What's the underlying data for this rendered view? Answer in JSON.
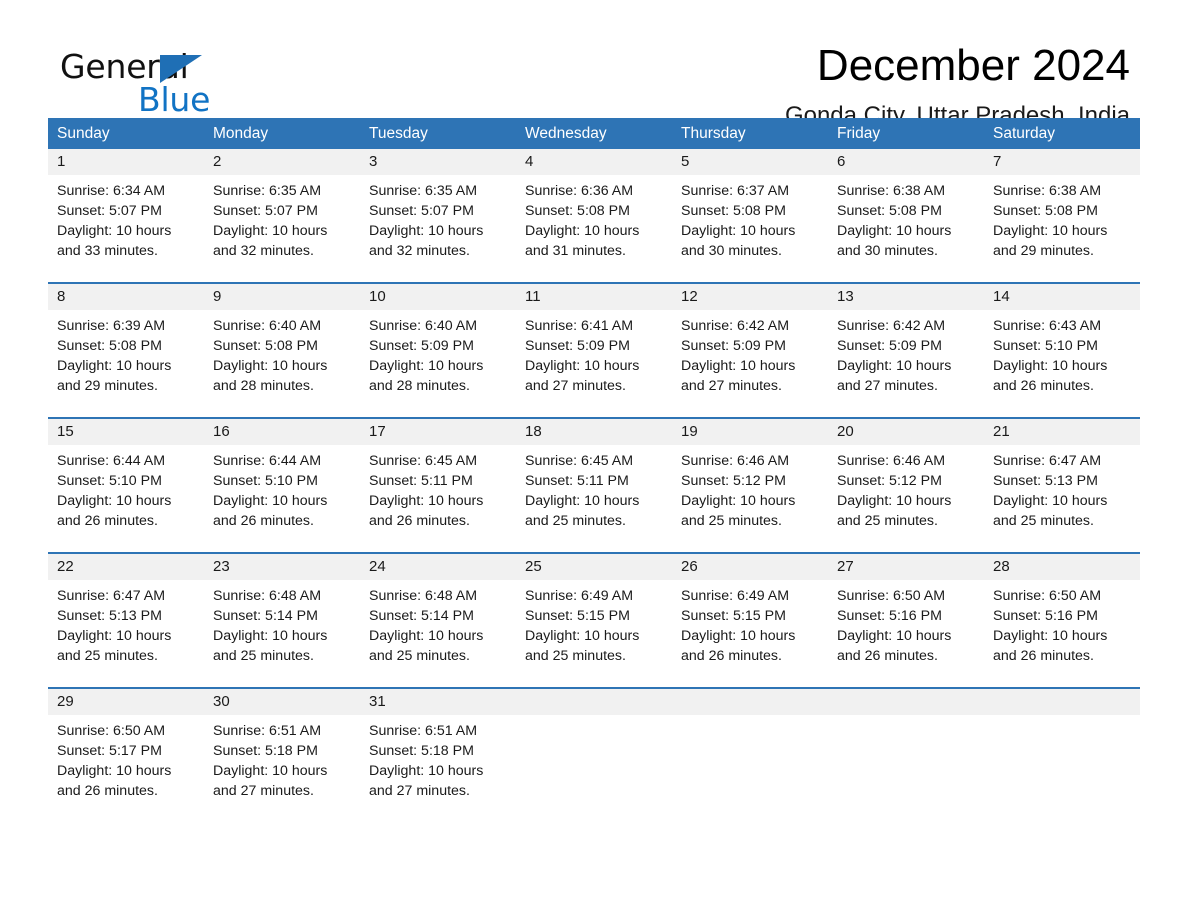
{
  "brand": {
    "word_black": "General",
    "word_blue": "Blue",
    "triangle_color": "#1f6fb5",
    "blue_color": "#1173c4"
  },
  "header": {
    "title": "December 2024",
    "location": "Gonda City, Uttar Pradesh, India"
  },
  "theme": {
    "header_blue": "#2e74b5",
    "rule_blue": "#2e74b5",
    "daynum_band": "#f1f1f1",
    "text": "#1a1a1a"
  },
  "weekdays": [
    "Sunday",
    "Monday",
    "Tuesday",
    "Wednesday",
    "Thursday",
    "Friday",
    "Saturday"
  ],
  "weeks": [
    {
      "days": [
        {
          "num": "1",
          "sunrise": "Sunrise: 6:34 AM",
          "sunset": "Sunset: 5:07 PM",
          "daylight": "Daylight: 10 hours and 33 minutes."
        },
        {
          "num": "2",
          "sunrise": "Sunrise: 6:35 AM",
          "sunset": "Sunset: 5:07 PM",
          "daylight": "Daylight: 10 hours and 32 minutes."
        },
        {
          "num": "3",
          "sunrise": "Sunrise: 6:35 AM",
          "sunset": "Sunset: 5:07 PM",
          "daylight": "Daylight: 10 hours and 32 minutes."
        },
        {
          "num": "4",
          "sunrise": "Sunrise: 6:36 AM",
          "sunset": "Sunset: 5:08 PM",
          "daylight": "Daylight: 10 hours and 31 minutes."
        },
        {
          "num": "5",
          "sunrise": "Sunrise: 6:37 AM",
          "sunset": "Sunset: 5:08 PM",
          "daylight": "Daylight: 10 hours and 30 minutes."
        },
        {
          "num": "6",
          "sunrise": "Sunrise: 6:38 AM",
          "sunset": "Sunset: 5:08 PM",
          "daylight": "Daylight: 10 hours and 30 minutes."
        },
        {
          "num": "7",
          "sunrise": "Sunrise: 6:38 AM",
          "sunset": "Sunset: 5:08 PM",
          "daylight": "Daylight: 10 hours and 29 minutes."
        }
      ]
    },
    {
      "days": [
        {
          "num": "8",
          "sunrise": "Sunrise: 6:39 AM",
          "sunset": "Sunset: 5:08 PM",
          "daylight": "Daylight: 10 hours and 29 minutes."
        },
        {
          "num": "9",
          "sunrise": "Sunrise: 6:40 AM",
          "sunset": "Sunset: 5:08 PM",
          "daylight": "Daylight: 10 hours and 28 minutes."
        },
        {
          "num": "10",
          "sunrise": "Sunrise: 6:40 AM",
          "sunset": "Sunset: 5:09 PM",
          "daylight": "Daylight: 10 hours and 28 minutes."
        },
        {
          "num": "11",
          "sunrise": "Sunrise: 6:41 AM",
          "sunset": "Sunset: 5:09 PM",
          "daylight": "Daylight: 10 hours and 27 minutes."
        },
        {
          "num": "12",
          "sunrise": "Sunrise: 6:42 AM",
          "sunset": "Sunset: 5:09 PM",
          "daylight": "Daylight: 10 hours and 27 minutes."
        },
        {
          "num": "13",
          "sunrise": "Sunrise: 6:42 AM",
          "sunset": "Sunset: 5:09 PM",
          "daylight": "Daylight: 10 hours and 27 minutes."
        },
        {
          "num": "14",
          "sunrise": "Sunrise: 6:43 AM",
          "sunset": "Sunset: 5:10 PM",
          "daylight": "Daylight: 10 hours and 26 minutes."
        }
      ]
    },
    {
      "days": [
        {
          "num": "15",
          "sunrise": "Sunrise: 6:44 AM",
          "sunset": "Sunset: 5:10 PM",
          "daylight": "Daylight: 10 hours and 26 minutes."
        },
        {
          "num": "16",
          "sunrise": "Sunrise: 6:44 AM",
          "sunset": "Sunset: 5:10 PM",
          "daylight": "Daylight: 10 hours and 26 minutes."
        },
        {
          "num": "17",
          "sunrise": "Sunrise: 6:45 AM",
          "sunset": "Sunset: 5:11 PM",
          "daylight": "Daylight: 10 hours and 26 minutes."
        },
        {
          "num": "18",
          "sunrise": "Sunrise: 6:45 AM",
          "sunset": "Sunset: 5:11 PM",
          "daylight": "Daylight: 10 hours and 25 minutes."
        },
        {
          "num": "19",
          "sunrise": "Sunrise: 6:46 AM",
          "sunset": "Sunset: 5:12 PM",
          "daylight": "Daylight: 10 hours and 25 minutes."
        },
        {
          "num": "20",
          "sunrise": "Sunrise: 6:46 AM",
          "sunset": "Sunset: 5:12 PM",
          "daylight": "Daylight: 10 hours and 25 minutes."
        },
        {
          "num": "21",
          "sunrise": "Sunrise: 6:47 AM",
          "sunset": "Sunset: 5:13 PM",
          "daylight": "Daylight: 10 hours and 25 minutes."
        }
      ]
    },
    {
      "days": [
        {
          "num": "22",
          "sunrise": "Sunrise: 6:47 AM",
          "sunset": "Sunset: 5:13 PM",
          "daylight": "Daylight: 10 hours and 25 minutes."
        },
        {
          "num": "23",
          "sunrise": "Sunrise: 6:48 AM",
          "sunset": "Sunset: 5:14 PM",
          "daylight": "Daylight: 10 hours and 25 minutes."
        },
        {
          "num": "24",
          "sunrise": "Sunrise: 6:48 AM",
          "sunset": "Sunset: 5:14 PM",
          "daylight": "Daylight: 10 hours and 25 minutes."
        },
        {
          "num": "25",
          "sunrise": "Sunrise: 6:49 AM",
          "sunset": "Sunset: 5:15 PM",
          "daylight": "Daylight: 10 hours and 25 minutes."
        },
        {
          "num": "26",
          "sunrise": "Sunrise: 6:49 AM",
          "sunset": "Sunset: 5:15 PM",
          "daylight": "Daylight: 10 hours and 26 minutes."
        },
        {
          "num": "27",
          "sunrise": "Sunrise: 6:50 AM",
          "sunset": "Sunset: 5:16 PM",
          "daylight": "Daylight: 10 hours and 26 minutes."
        },
        {
          "num": "28",
          "sunrise": "Sunrise: 6:50 AM",
          "sunset": "Sunset: 5:16 PM",
          "daylight": "Daylight: 10 hours and 26 minutes."
        }
      ]
    },
    {
      "days": [
        {
          "num": "29",
          "sunrise": "Sunrise: 6:50 AM",
          "sunset": "Sunset: 5:17 PM",
          "daylight": "Daylight: 10 hours and 26 minutes."
        },
        {
          "num": "30",
          "sunrise": "Sunrise: 6:51 AM",
          "sunset": "Sunset: 5:18 PM",
          "daylight": "Daylight: 10 hours and 27 minutes."
        },
        {
          "num": "31",
          "sunrise": "Sunrise: 6:51 AM",
          "sunset": "Sunset: 5:18 PM",
          "daylight": "Daylight: 10 hours and 27 minutes."
        },
        {
          "num": "",
          "sunrise": "",
          "sunset": "",
          "daylight": ""
        },
        {
          "num": "",
          "sunrise": "",
          "sunset": "",
          "daylight": ""
        },
        {
          "num": "",
          "sunrise": "",
          "sunset": "",
          "daylight": ""
        },
        {
          "num": "",
          "sunrise": "",
          "sunset": "",
          "daylight": ""
        }
      ]
    }
  ]
}
